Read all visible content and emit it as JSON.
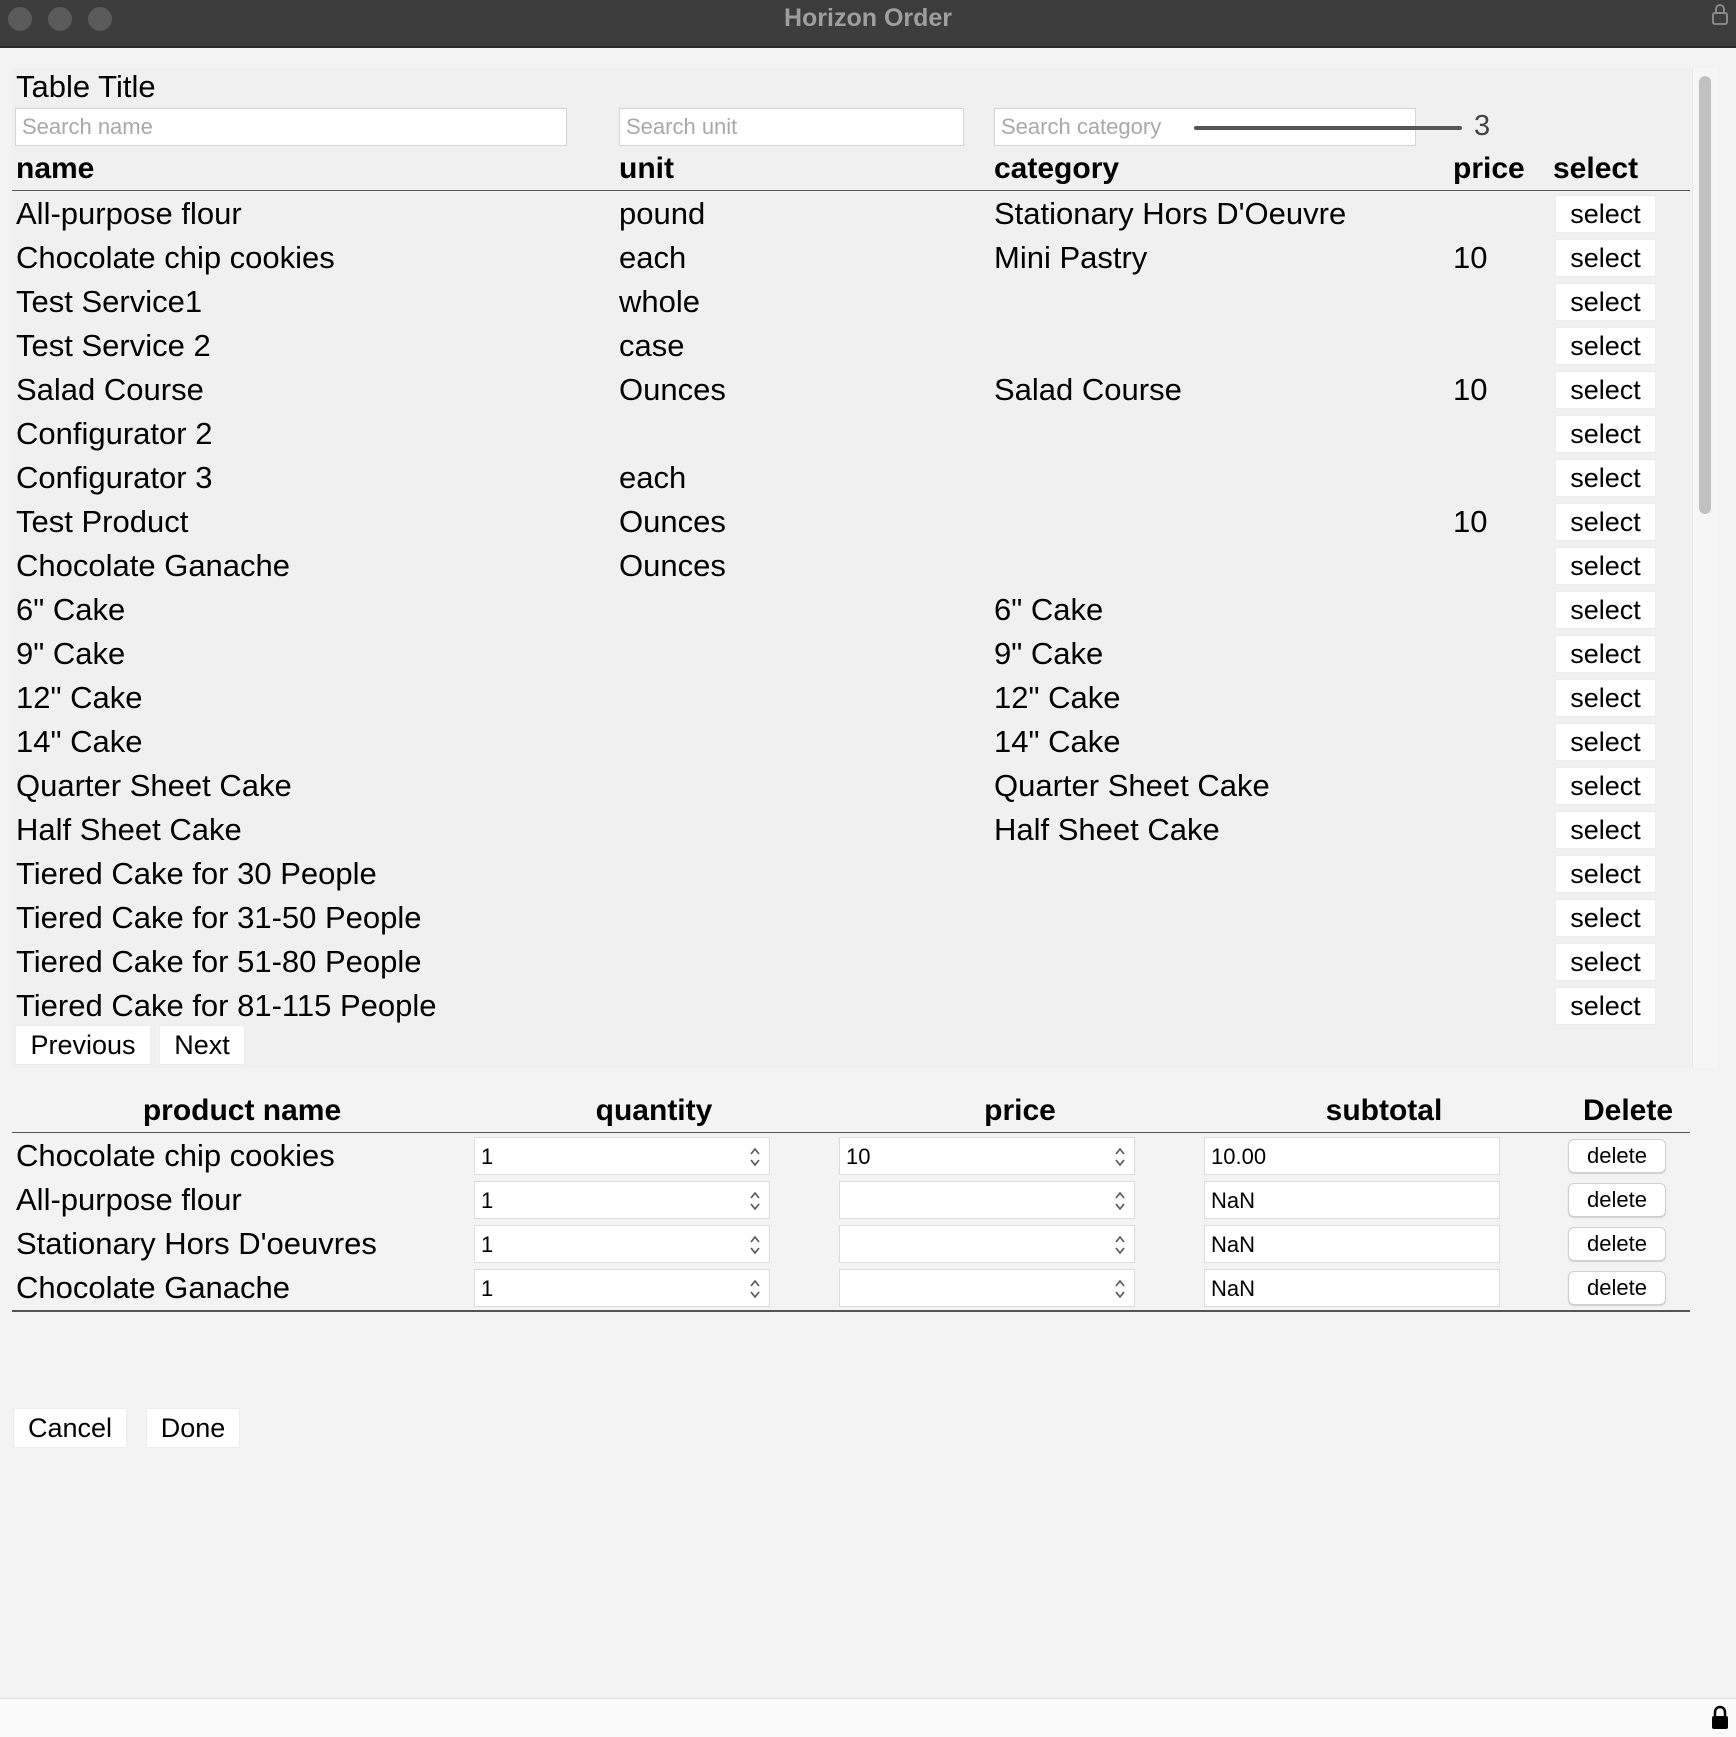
{
  "window": {
    "title": "Horizon Order"
  },
  "products": {
    "title": "Table Title",
    "search": {
      "name_placeholder": "Search name",
      "unit_placeholder": "Search unit",
      "category_placeholder": "Search category"
    },
    "page_size_value": "3",
    "page_size_fraction": 1.0,
    "columns": [
      "name",
      "unit",
      "category",
      "price",
      "select"
    ],
    "select_label": "select",
    "rows": [
      {
        "name": "All-purpose flour",
        "unit": "pound",
        "category": "Stationary Hors D'Oeuvre",
        "price": ""
      },
      {
        "name": "Chocolate chip cookies",
        "unit": "each",
        "category": "Mini Pastry",
        "price": "10"
      },
      {
        "name": "Test Service1",
        "unit": "whole",
        "category": "",
        "price": ""
      },
      {
        "name": "Test Service 2",
        "unit": "case",
        "category": "",
        "price": ""
      },
      {
        "name": "Salad Course",
        "unit": "Ounces",
        "category": "Salad Course",
        "price": "10"
      },
      {
        "name": "Configurator 2",
        "unit": "",
        "category": "",
        "price": ""
      },
      {
        "name": "Configurator 3",
        "unit": "each",
        "category": "",
        "price": ""
      },
      {
        "name": "Test Product",
        "unit": "Ounces",
        "category": "",
        "price": "10"
      },
      {
        "name": "Chocolate Ganache",
        "unit": "Ounces",
        "category": "",
        "price": ""
      },
      {
        "name": "6\" Cake",
        "unit": "",
        "category": "6\" Cake",
        "price": ""
      },
      {
        "name": "9\" Cake",
        "unit": "",
        "category": "9\" Cake",
        "price": ""
      },
      {
        "name": "12\" Cake",
        "unit": "",
        "category": "12\" Cake",
        "price": ""
      },
      {
        "name": "14\" Cake",
        "unit": "",
        "category": "14\" Cake",
        "price": ""
      },
      {
        "name": "Quarter Sheet Cake",
        "unit": "",
        "category": "Quarter Sheet Cake",
        "price": ""
      },
      {
        "name": "Half Sheet Cake",
        "unit": "",
        "category": "Half Sheet Cake",
        "price": ""
      },
      {
        "name": "Tiered Cake for 30 People",
        "unit": "",
        "category": "",
        "price": ""
      },
      {
        "name": "Tiered Cake for 31-50 People",
        "unit": "",
        "category": "",
        "price": ""
      },
      {
        "name": "Tiered Cake for 51-80 People",
        "unit": "",
        "category": "",
        "price": ""
      },
      {
        "name": "Tiered Cake for 81-115 People",
        "unit": "",
        "category": "",
        "price": ""
      }
    ],
    "pager": {
      "previous": "Previous",
      "next": "Next"
    }
  },
  "order": {
    "columns": [
      "product name",
      "quantity",
      "price",
      "subtotal",
      "Delete"
    ],
    "delete_label": "delete",
    "rows": [
      {
        "product": "Chocolate chip cookies",
        "quantity": "1",
        "price": "10",
        "subtotal": "10.00"
      },
      {
        "product": "All-purpose flour",
        "quantity": "1",
        "price": "",
        "subtotal": "NaN"
      },
      {
        "product": "Stationary Hors D'oeuvres",
        "quantity": "1",
        "price": "",
        "subtotal": "NaN"
      },
      {
        "product": "Chocolate Ganache",
        "quantity": "1",
        "price": "",
        "subtotal": "NaN"
      }
    ]
  },
  "actions": {
    "cancel": "Cancel",
    "done": "Done"
  }
}
